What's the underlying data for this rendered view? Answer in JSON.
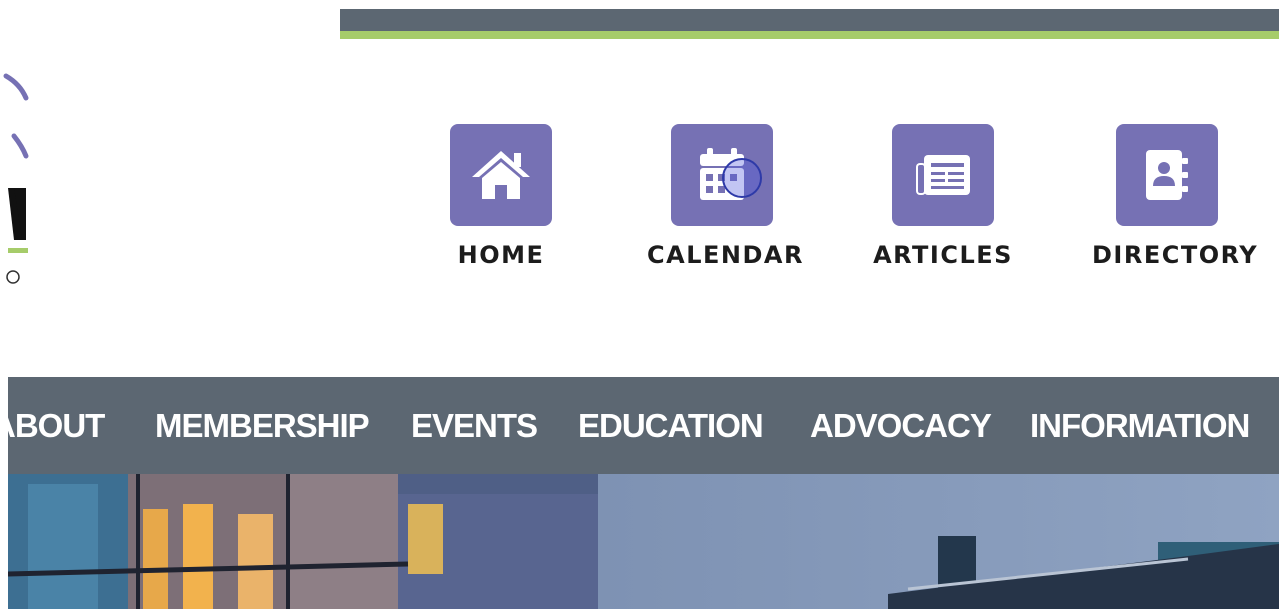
{
  "quick_links": [
    {
      "label": "HOME",
      "icon": "home-icon"
    },
    {
      "label": "CALENDAR",
      "icon": "calendar-icon"
    },
    {
      "label": "ARTICLES",
      "icon": "newspaper-icon"
    },
    {
      "label": "DIRECTORY",
      "icon": "address-book-icon"
    }
  ],
  "main_nav": [
    {
      "label": "ABOUT"
    },
    {
      "label": "MEMBERSHIP"
    },
    {
      "label": "EVENTS"
    },
    {
      "label": "EDUCATION"
    },
    {
      "label": "ADVOCACY"
    },
    {
      "label": "INFORMATION"
    }
  ],
  "colors": {
    "bar_gray": "#5c6772",
    "accent_green": "#a6cc6a",
    "tile_purple": "#7671b4"
  }
}
